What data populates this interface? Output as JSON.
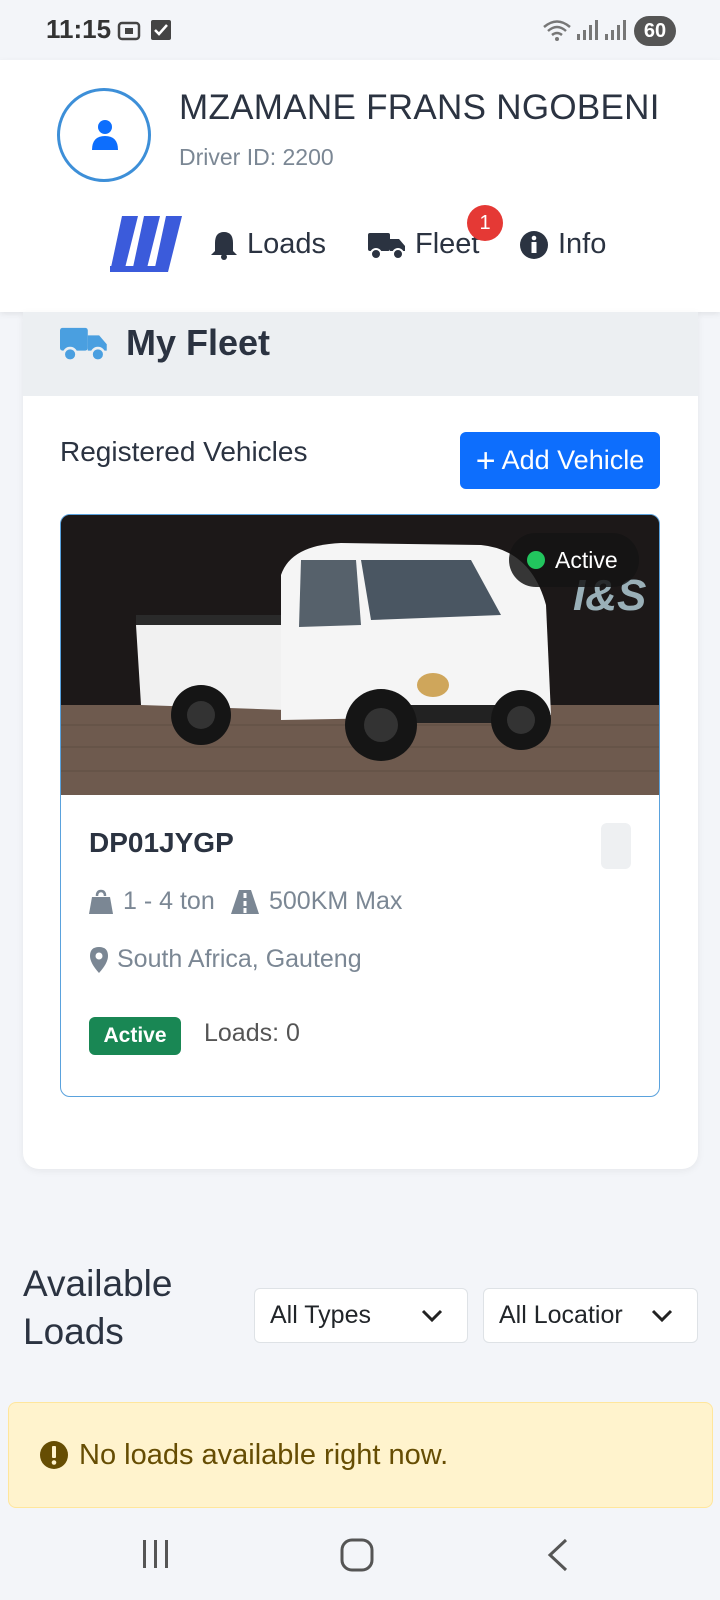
{
  "status_bar": {
    "time": "11:15",
    "battery": "60"
  },
  "header": {
    "driver_name": "MZAMANE FRANS NGOBENI",
    "driver_id": "Driver ID: 2200",
    "nav": {
      "loads": "Loads",
      "fleet": "Fleet",
      "fleet_badge": "1",
      "info": "Info"
    }
  },
  "fleet": {
    "title": "My Fleet",
    "registered_label": "Registered Vehicles",
    "add_button": "Add Vehicle",
    "vehicle": {
      "status_pill": "Active",
      "plate": "DP01JYGP",
      "capacity": "1 - 4 ton",
      "range": "500KM Max",
      "location": "South Africa, Gauteng",
      "status_badge": "Active",
      "loads": "Loads: 0"
    }
  },
  "available_loads": {
    "title_line1": "Available",
    "title_line2": "Loads",
    "type_filter": "All Types",
    "location_filter": "All Locatior",
    "empty_message": "No loads available right now."
  },
  "colors": {
    "primary": "#0d6efd",
    "success": "#198754",
    "badge": "#e53935",
    "warning_bg": "#fff3cd"
  }
}
